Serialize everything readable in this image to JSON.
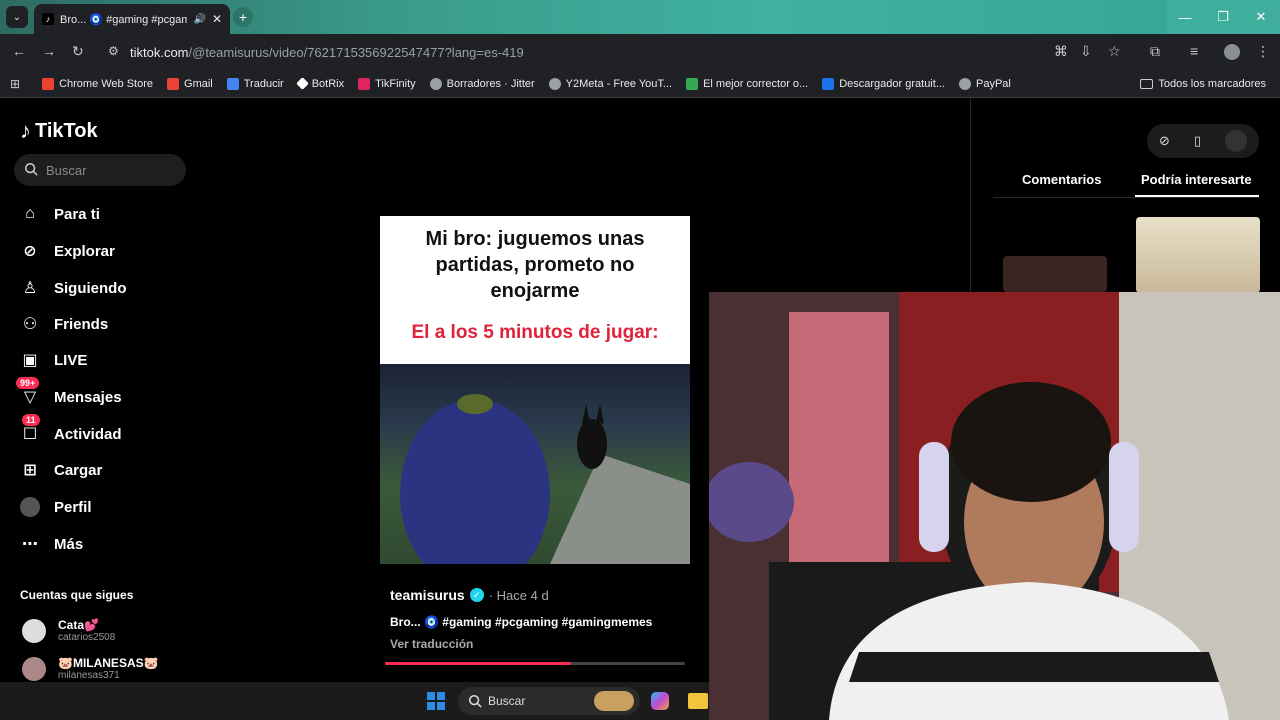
{
  "browser": {
    "tab_title": "Bro... 🧿 #gaming #pcgam",
    "tab_favicon": "tiktok-icon",
    "url_host": "tiktok.com",
    "url_path": "/@teamisurus/video/7621715356922547477?lang=es-419",
    "bookmarks": [
      {
        "label": "Chrome Web Store",
        "color": "#e94235"
      },
      {
        "label": "Gmail",
        "color": "#ea4335"
      },
      {
        "label": "Traducir",
        "color": "#4285f4"
      },
      {
        "label": "BotRix",
        "color": "#ffffff"
      },
      {
        "label": "TikFinity",
        "color": "#e0245e"
      },
      {
        "label": "Borradores · Jitter",
        "color": "#9aa0a6"
      },
      {
        "label": "Y2Meta - Free YouT...",
        "color": "#9aa0a6"
      },
      {
        "label": "El mejor corrector o...",
        "color": "#34a853"
      },
      {
        "label": "Descargador gratuit...",
        "color": "#1a73e8"
      },
      {
        "label": "PayPal",
        "color": "#9aa0a6"
      }
    ],
    "all_bookmarks": "Todos los marcadores"
  },
  "tiktok": {
    "logo": "TikTok",
    "search_placeholder": "Buscar",
    "nav": [
      {
        "label": "Para ti",
        "icon": "home-icon"
      },
      {
        "label": "Explorar",
        "icon": "compass-icon"
      },
      {
        "label": "Siguiendo",
        "icon": "following-icon"
      },
      {
        "label": "Friends",
        "icon": "friends-icon"
      },
      {
        "label": "LIVE",
        "icon": "live-icon"
      },
      {
        "label": "Mensajes",
        "icon": "messages-icon",
        "badge": "99+"
      },
      {
        "label": "Actividad",
        "icon": "activity-icon",
        "badge": "11"
      },
      {
        "label": "Cargar",
        "icon": "upload-icon"
      },
      {
        "label": "Perfil",
        "icon": "avatar"
      },
      {
        "label": "Más",
        "icon": "more-icon"
      }
    ],
    "following_title": "Cuentas que sigues",
    "following": [
      {
        "name": "Cata💕",
        "handle": "catarios2508"
      },
      {
        "name": "🐷MILANESAS🐷",
        "handle": "milanesas371"
      }
    ]
  },
  "video": {
    "caption_top": "Mi bro: juguemos unas partidas, prometo no enojarme",
    "caption_red": "El a los 5 minutos de jugar:",
    "author": "teamisurus",
    "ago": "· Hace 4 d",
    "description": "Bro... 🧿 #gaming #pcgaming #gamingmemes",
    "translate": "Ver traducción",
    "progress": 0.62
  },
  "right_panel": {
    "tab_comments": "Comentarios",
    "tab_interest": "Podría interesarte"
  },
  "taskbar": {
    "search": "Buscar"
  }
}
